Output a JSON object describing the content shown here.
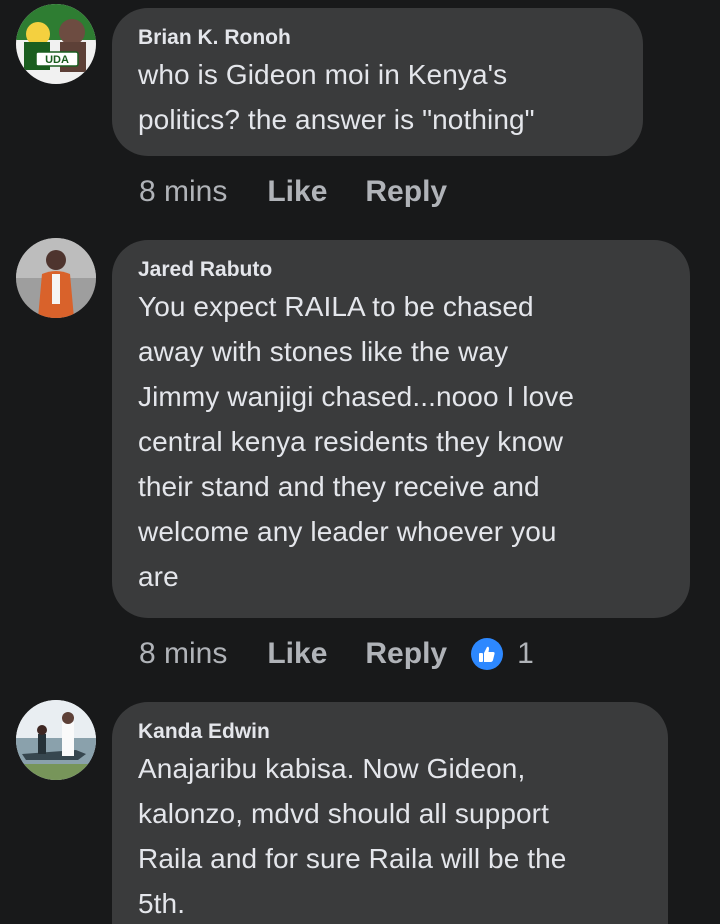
{
  "comments": [
    {
      "author": "Brian K. Ronoh",
      "avatar_icon": "uda-logo-avatar",
      "avatar_text": "UDA",
      "lines": [
        "who is Gideon moi in Kenya's",
        "politics? the answer is \"nothing\""
      ],
      "time": "8 mins",
      "like_label": "Like",
      "reply_label": "Reply"
    },
    {
      "author": "Jared Rabuto",
      "avatar_icon": "person-photo-avatar",
      "lines": [
        "You expect RAILA to be chased",
        "away with stones like the way",
        "Jimmy wanjigi chased...nooo I love",
        "central kenya residents they know",
        "their stand and they receive and",
        "welcome any leader whoever you",
        "are"
      ],
      "time": "8 mins",
      "like_label": "Like",
      "reply_label": "Reply",
      "reaction_icon": "thumbs-up-icon",
      "reaction_count": "1"
    },
    {
      "author": "Kanda Edwin",
      "avatar_icon": "boat-photo-avatar",
      "lines": [
        "Anajaribu kabisa. Now Gideon,",
        "kalonzo, mdvd should all support",
        "Raila and for sure Raila will be the",
        "5th."
      ]
    }
  ],
  "colors": {
    "background": "#18191a",
    "bubble": "#3a3b3c",
    "text": "#e4e6eb",
    "secondary_text": "#b0b3b8",
    "reaction_blue": "#2d88ff"
  }
}
